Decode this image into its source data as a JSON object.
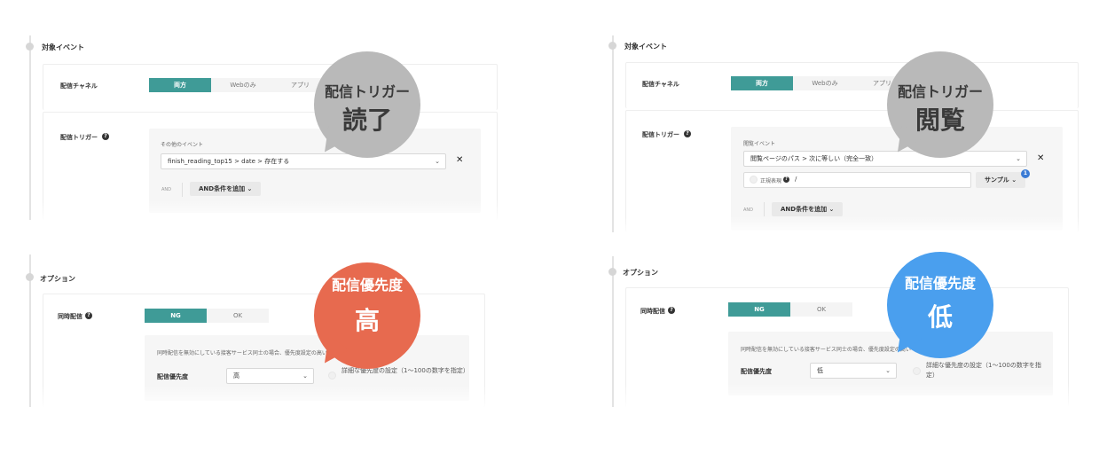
{
  "left": {
    "event": {
      "section_title": "対象イベント",
      "channel_label": "配信チャネル",
      "channel_options": [
        "両方",
        "Webのみ",
        "アプリ"
      ],
      "trigger_label": "配信トリガー",
      "help_glyph": "?",
      "other_event_label": "その他のイベント",
      "event_value": "finish_reading_top15 > date > 存在する",
      "remove_glyph": "✕",
      "and_label": "AND",
      "add_and_button": "AND条件を追加"
    },
    "option": {
      "section_title": "オプション",
      "concurrent_label": "同時配信",
      "help_glyph": "?",
      "toggle": [
        "NG",
        "OK"
      ],
      "note": "同時配信を無効にしている接客サービス同士の場合、優先度設定の高いものが一つ",
      "priority_label": "配信優先度",
      "priority_value": "高",
      "detail_priority": "詳細な優先度の設定（1〜100の数字を指定）"
    },
    "callout_top": {
      "line1": "配信トリガー",
      "line2": "読了",
      "color": "#b9b9b9"
    },
    "callout_bottom": {
      "line1": "配信優先度",
      "line2": "高",
      "color": "#e76a4f"
    }
  },
  "right": {
    "event": {
      "section_title": "対象イベント",
      "channel_label": "配信チャネル",
      "channel_options": [
        "両方",
        "Webのみ",
        "アプリ"
      ],
      "trigger_label": "配信トリガー",
      "help_glyph": "?",
      "browse_event_label": "閲覧イベント",
      "event_value": "閲覧ページのパス > 次に等しい（完全一致）",
      "regex_label": "正規表現",
      "path_value": "/",
      "sample_button": "サンプル",
      "sample_badge": "1",
      "remove_glyph": "✕",
      "and_label": "AND",
      "add_and_button": "AND条件を追加"
    },
    "option": {
      "section_title": "オプション",
      "concurrent_label": "同時配信",
      "help_glyph": "?",
      "toggle": [
        "NG",
        "OK"
      ],
      "note": "同時配信を無効にしている接客サービス同士の場合、優先度設定の高い",
      "priority_label": "配信優先度",
      "priority_value": "低",
      "detail_priority": "詳細な優先度の設定（1〜100の数字を指定）"
    },
    "callout_top": {
      "line1": "配信トリガー",
      "line2": "閲覧",
      "color": "#b9b9b9"
    },
    "callout_bottom": {
      "line1": "配信優先度",
      "line2": "低",
      "color": "#4a9fee"
    }
  },
  "icons": {
    "chevron": "chevron-down-icon",
    "close": "close-icon",
    "help": "help-icon"
  }
}
